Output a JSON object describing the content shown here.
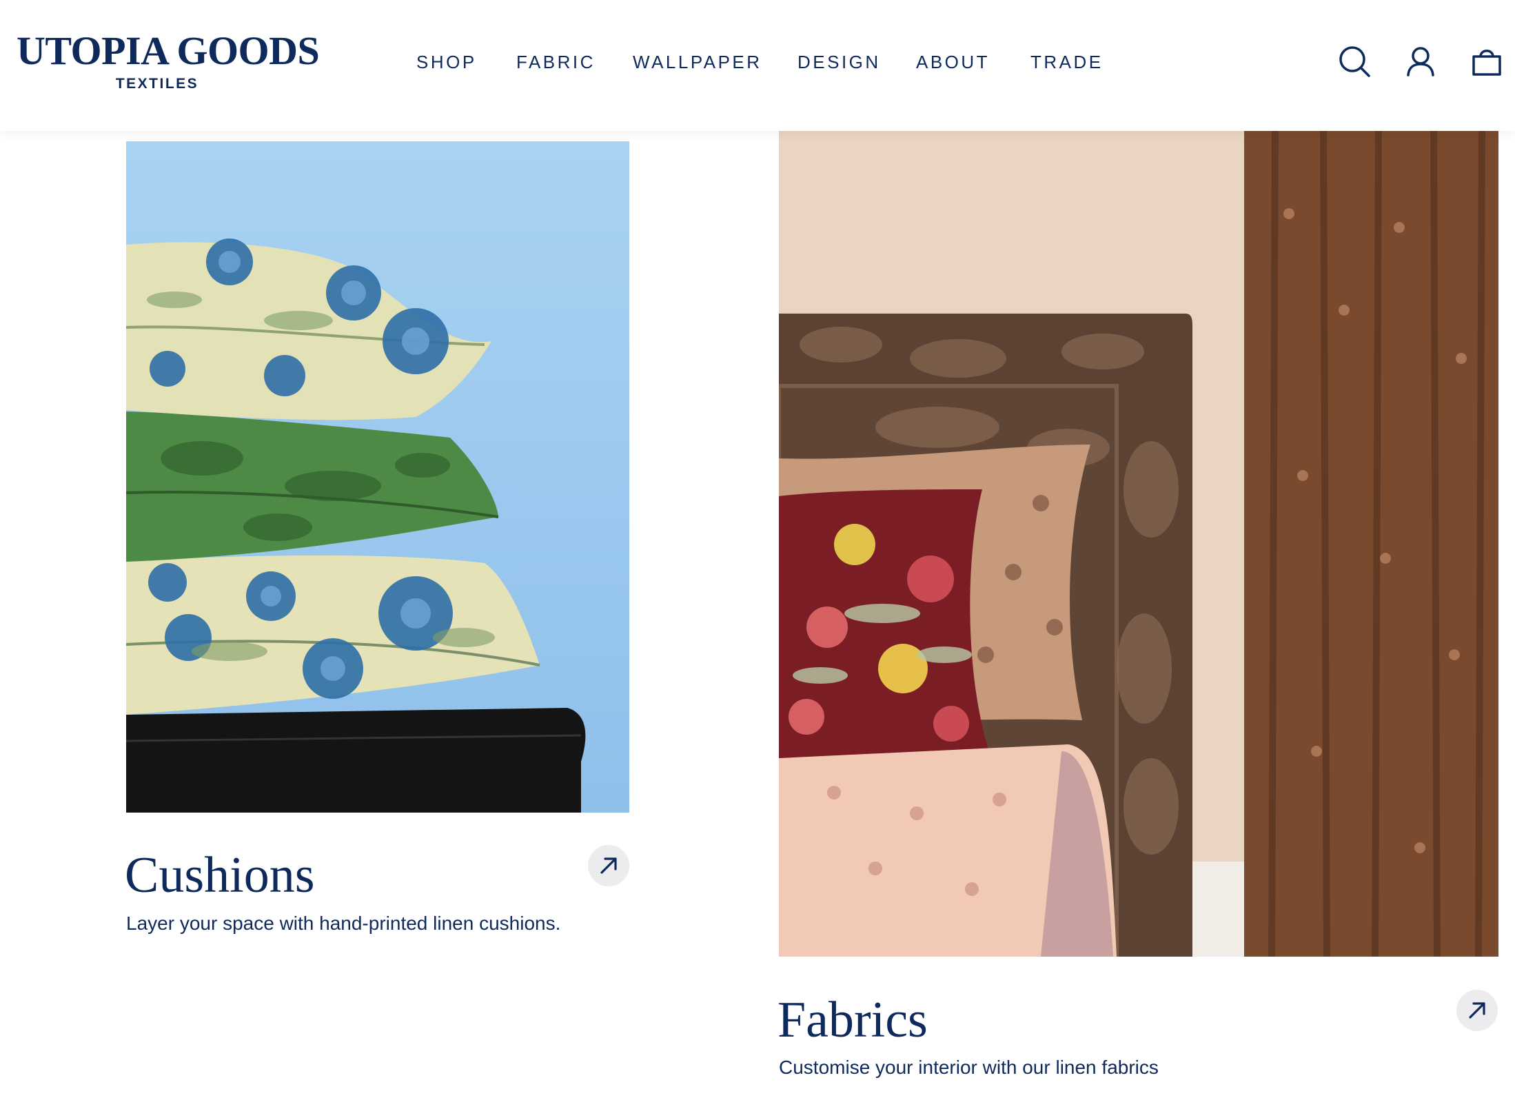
{
  "brand": {
    "name": "UTOPIA GOODS",
    "sub": "TEXTILES"
  },
  "nav": {
    "items": [
      {
        "label": "SHOP"
      },
      {
        "label": "FABRIC"
      },
      {
        "label": "WALLPAPER"
      },
      {
        "label": "DESIGN"
      },
      {
        "label": "ABOUT"
      },
      {
        "label": "TRADE"
      }
    ]
  },
  "header_icons": [
    "search-icon",
    "account-icon",
    "cart-icon"
  ],
  "cards": [
    {
      "title": "Cushions",
      "description": "Layer your space with hand-printed linen cushions.",
      "image": "stacked-floral-cushions-image",
      "arrow_icon": "arrow-up-right-icon"
    },
    {
      "title": "Fabrics",
      "description": "Customise your interior with our linen fabrics",
      "image": "bedroom-fabrics-image",
      "arrow_icon": "arrow-up-right-icon"
    }
  ],
  "colors": {
    "brand_navy": "#0e2a5c",
    "arrow_button_bg": "#ececee",
    "header_bg": "#ffffff"
  }
}
